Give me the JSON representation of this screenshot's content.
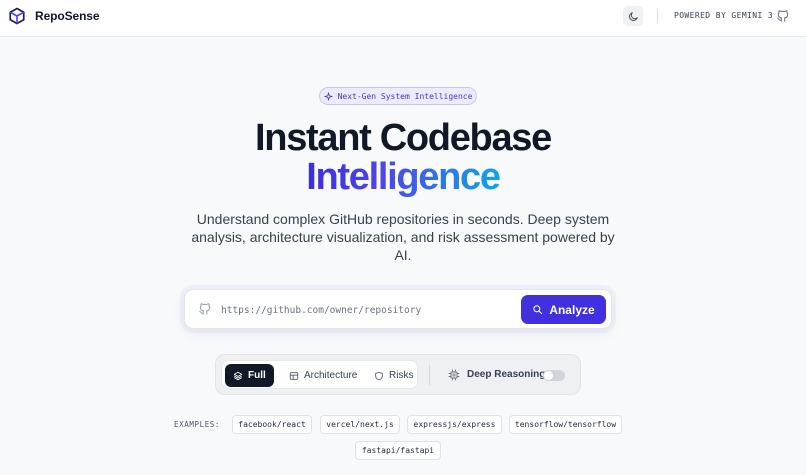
{
  "header": {
    "app_title": "RepoSense",
    "powered_by": "POWERED BY GEMINI 3",
    "icons": {
      "logo": "cube-logo-icon",
      "theme": "moon-icon",
      "github": "github-icon"
    }
  },
  "hero": {
    "badge": "Next-Gen System Intelligence",
    "title_line1": "Instant Codebase",
    "title_line2": "Intelligence",
    "subtitle": "Understand complex GitHub repositories in seconds. Deep system analysis, architecture visualization, and risk assessment powered by AI."
  },
  "search": {
    "placeholder": "https://github.com/owner/repository",
    "value": "",
    "button_label": "Analyze"
  },
  "modes": {
    "options": [
      "Full",
      "Architecture",
      "Risks"
    ],
    "selected": "Full",
    "deep_reasoning_label": "Deep Reasoning",
    "deep_reasoning_enabled": false
  },
  "examples": {
    "label": "EXAMPLES:",
    "items": [
      "facebook/react",
      "vercel/next.js",
      "expressjs/express",
      "tensorflow/tensorflow",
      "fastapi/fastapi"
    ]
  },
  "colors": {
    "accent": "#4130e0",
    "gradient_start": "#3b2ee0",
    "gradient_end": "#0ea5e9",
    "active_segment": "#111827"
  }
}
